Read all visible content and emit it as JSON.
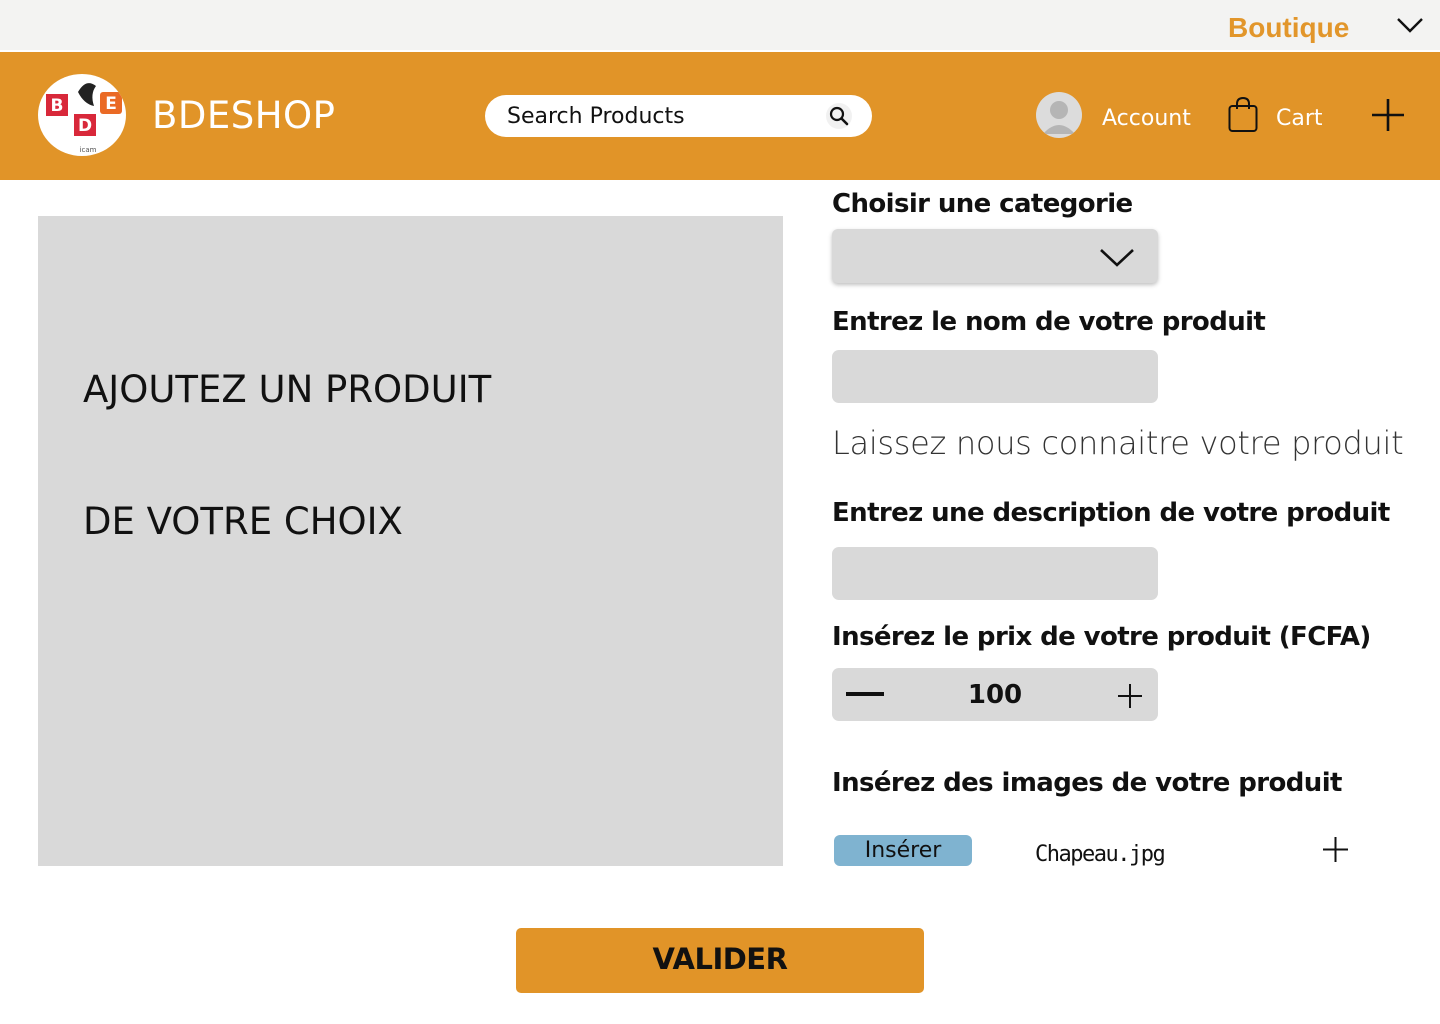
{
  "topbar": {
    "menu_label": "Boutique",
    "menu_icon": "chevron-down-icon"
  },
  "header": {
    "logo_letters": [
      "B",
      "D",
      "E"
    ],
    "logo_caption": "icam",
    "brand": "BDESHOP",
    "search_placeholder": "Search Products",
    "search_icon": "search-icon",
    "account_label": "Account",
    "cart_label": "Cart",
    "add_icon": "plus-icon"
  },
  "preview": {
    "line1": "AJOUTEZ UN PRODUIT",
    "line2": "DE VOTRE CHOIX"
  },
  "form": {
    "category_label": "Choisir une categorie",
    "category_value": "",
    "name_label": "Entrez le nom de votre produit",
    "name_value": "",
    "name_hint": "Laissez nous connaitre votre produit",
    "description_label": "Entrez une description de votre produit",
    "description_value": "",
    "price_label": "Insérez le prix de votre produit (FCFA)",
    "price_value": "100",
    "images_label": "Insérez des images de votre produit",
    "insert_button": "Insérer",
    "file_name": "Chapeau.jpg",
    "submit_button": "VALIDER"
  },
  "colors": {
    "accent": "#e19428",
    "topbar_bg": "#f3f3f2",
    "field_bg": "#d9d9d9",
    "insert_button_bg": "#7fb3d0",
    "boutique_text": "#e2962b"
  }
}
